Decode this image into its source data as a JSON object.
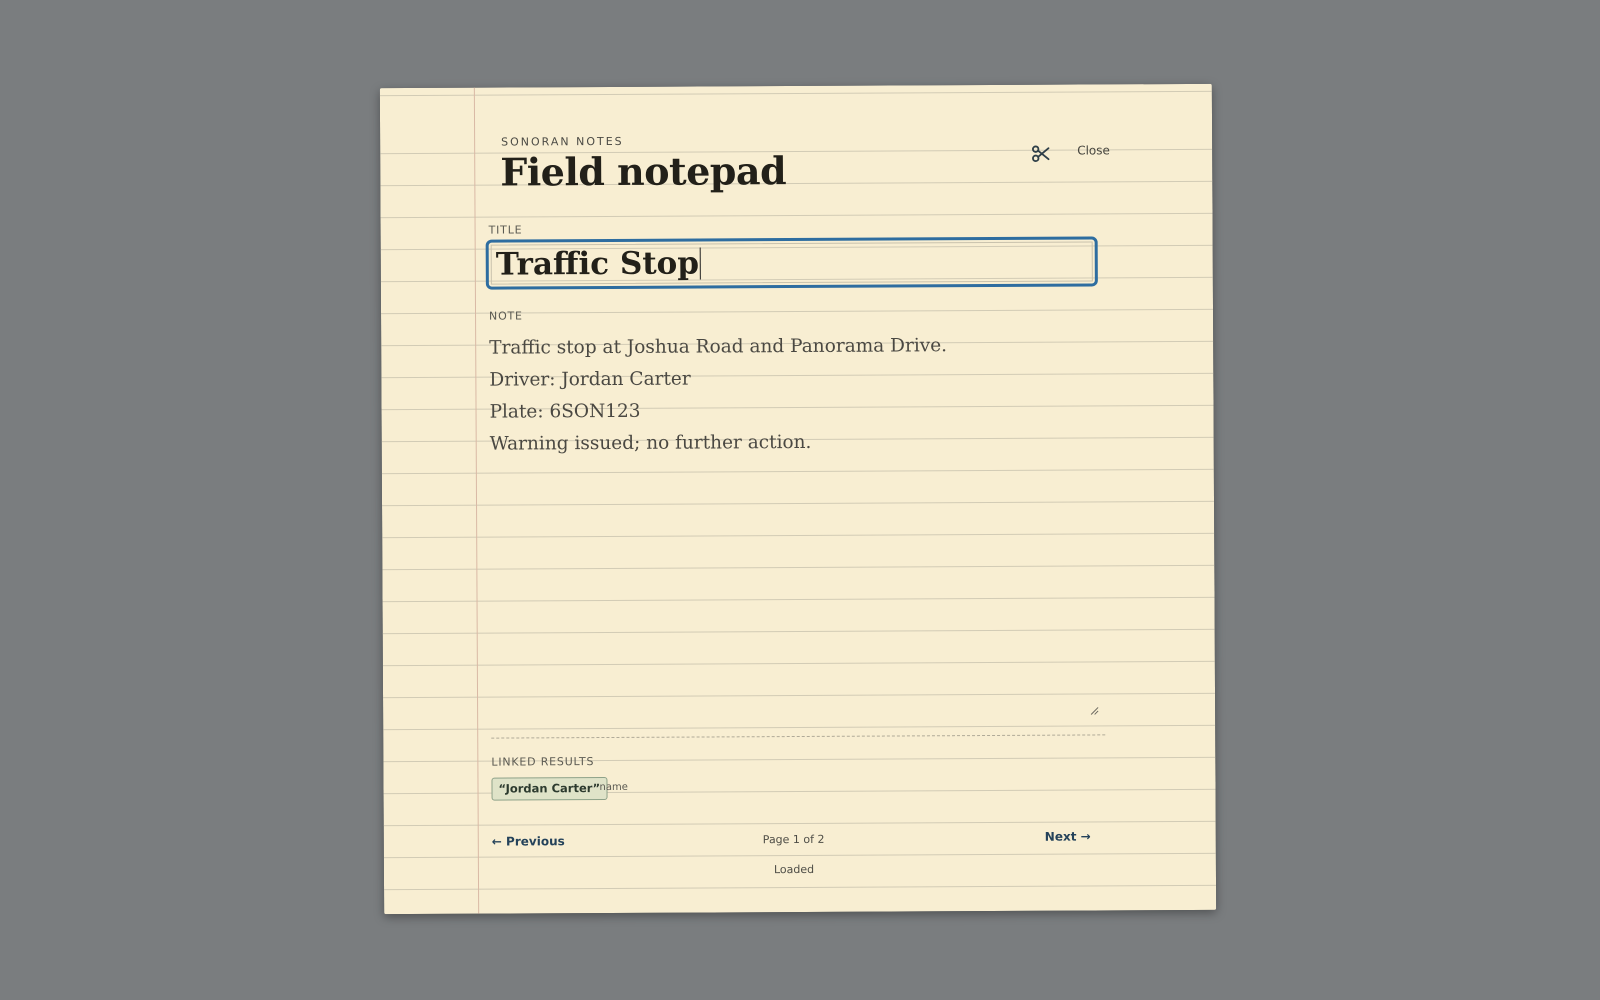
{
  "app": {
    "brand": "SONORAN NOTES",
    "title": "Field notepad",
    "close_label": "Close"
  },
  "title_field": {
    "label": "TITLE",
    "value": "Traffic Stop"
  },
  "note_field": {
    "label": "NOTE",
    "lines": [
      "Traffic stop at Joshua Road and Panorama Drive.",
      "Driver: Jordan Carter",
      "Plate: 6SON123",
      "Warning issued; no further action."
    ]
  },
  "linked": {
    "label": "LINKED RESULTS",
    "items": [
      {
        "text": "“Jordan Carter”",
        "type": "name"
      }
    ]
  },
  "pager": {
    "previous": "← Previous",
    "next": "Next →",
    "indicator": "Page 1 of 2"
  },
  "status": "Loaded",
  "icons": {
    "close": "scissors-icon"
  },
  "colors": {
    "paper": "#f8eed2",
    "focus_ring": "#2e6da0",
    "chip_bg": "#dfe3c8",
    "backdrop": "#7a7d7f"
  }
}
